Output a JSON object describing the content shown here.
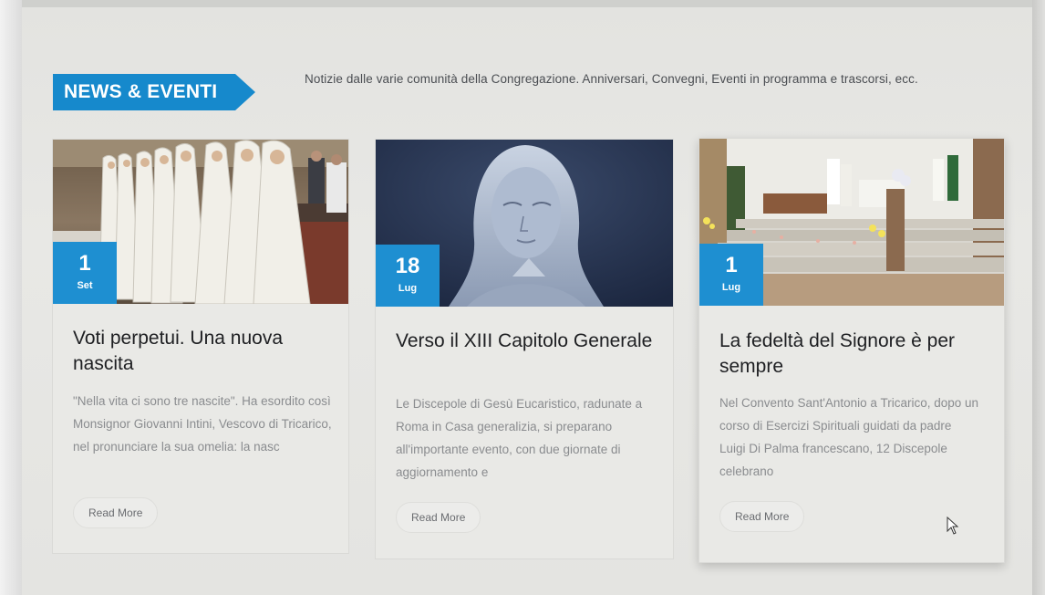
{
  "header": {
    "tag_label": "NEWS & EVENTI",
    "description": "Notizie dalle varie comunità della Congregazione. Anniversari, Convegni, Eventi in programma e trascorsi, ecc."
  },
  "cards": [
    {
      "day": "1",
      "month": "Set",
      "title": "Voti perpetui. Una nuova nascita",
      "excerpt": "\"Nella vita ci sono tre nascite\".  Ha esordito così Monsignor Giovanni Intini, Vescovo di Tricarico, nel pronunciare la sua omelia: la nasc",
      "read_more": "Read More"
    },
    {
      "day": "18",
      "month": "Lug",
      "title": "Verso il XIII Capitolo Generale",
      "excerpt": "Le Discepole di Gesù Eucaristico, radunate a Roma in Casa generalizia, si preparano all'importante evento, con due giornate di aggiornamento e",
      "read_more": "Read More"
    },
    {
      "day": "1",
      "month": "Lug",
      "title": "La fedeltà del Signore è per sempre",
      "excerpt": "Nel Convento Sant'Antonio a Tricarico, dopo un corso di Esercizi Spirituali guidati da padre Luigi Di Palma francescano, 12 Discepole celebrano",
      "read_more": "Read More"
    }
  ],
  "colors": {
    "accent": "#1689cc",
    "badge": "#1e8fd1",
    "title_text": "#1e1f22",
    "excerpt_text": "#8a8c8f"
  }
}
